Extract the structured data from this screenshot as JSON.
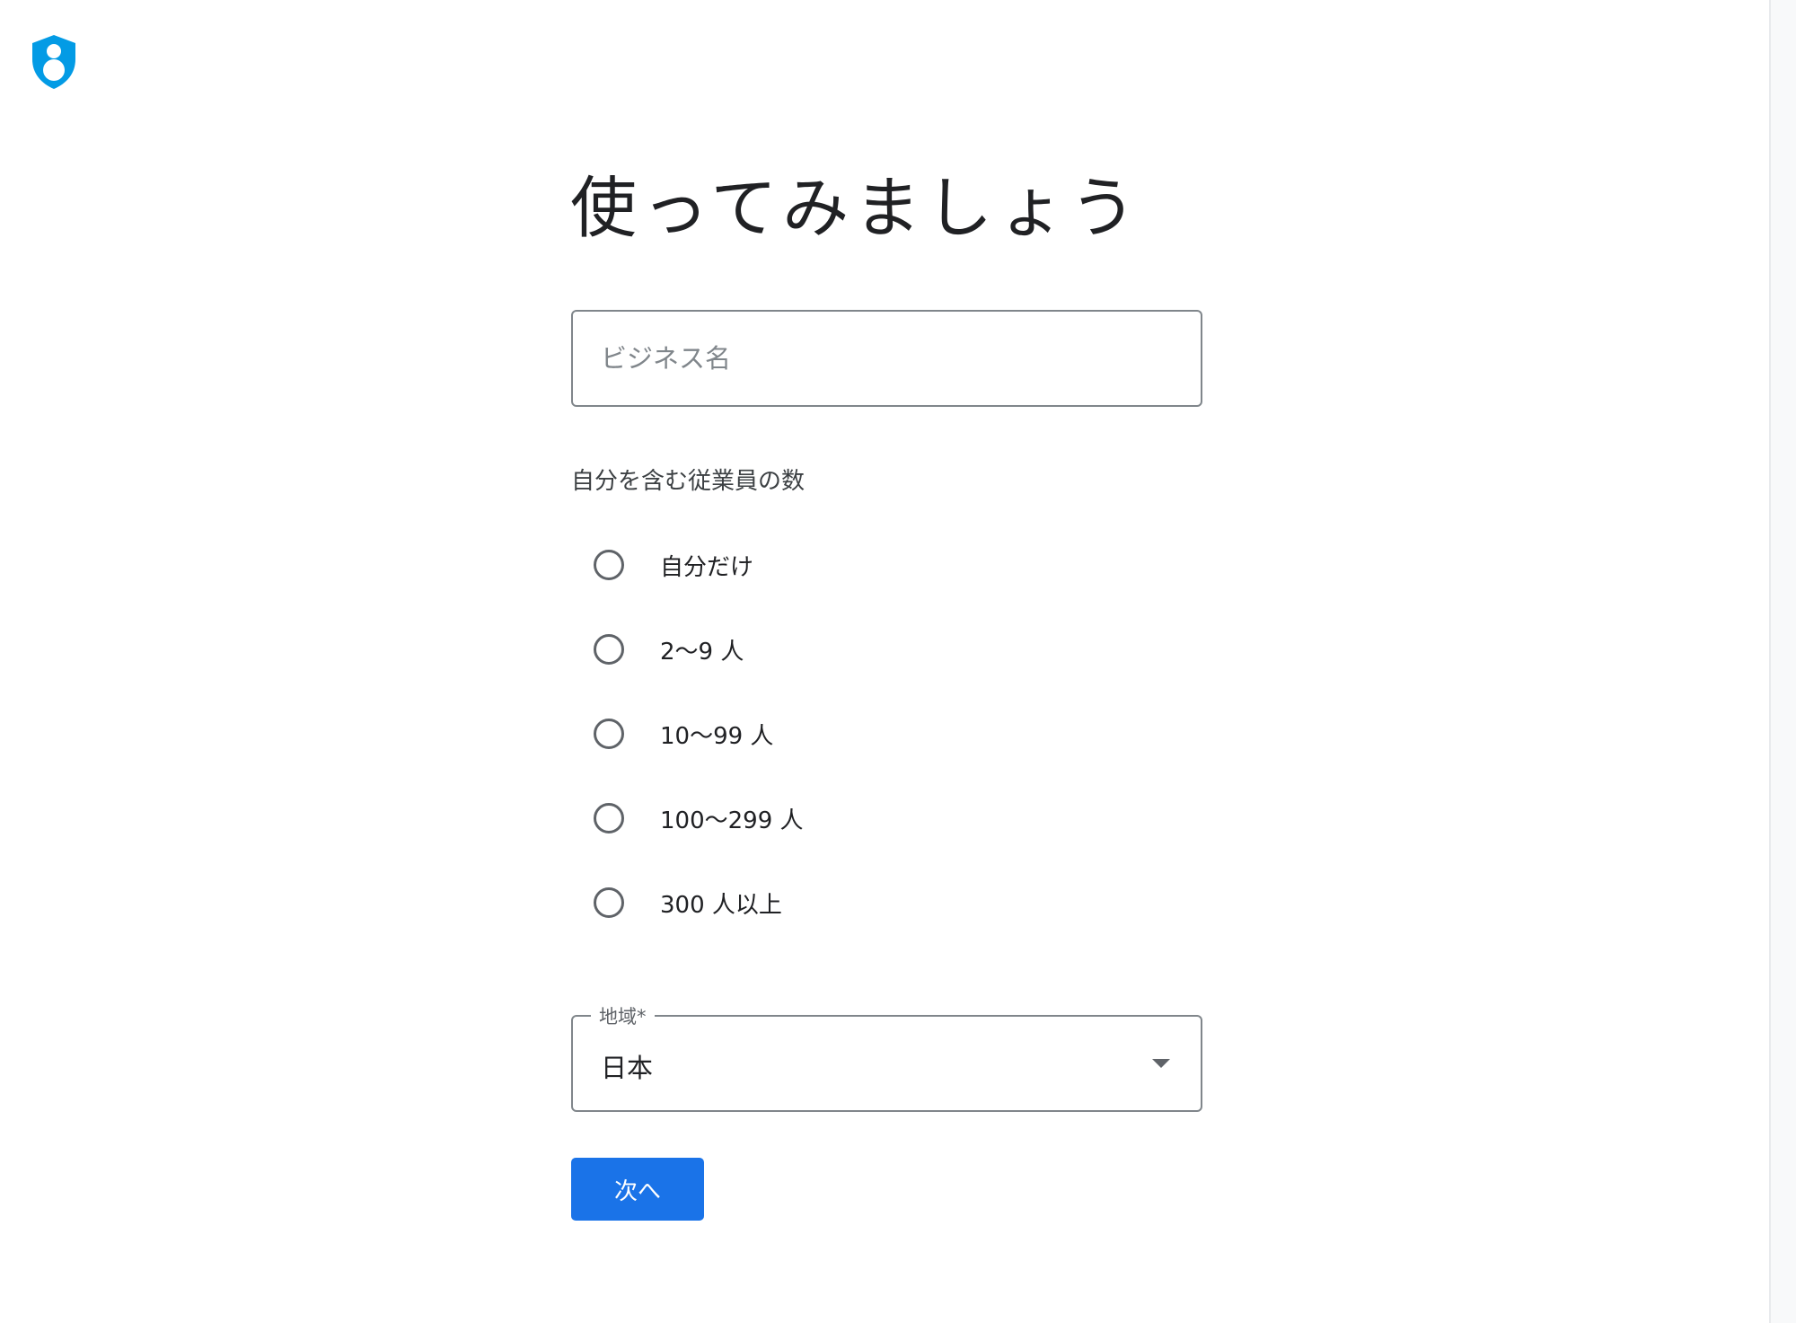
{
  "app": {
    "logo_icon": "shield-person-icon",
    "accent_color": "#1a73e8"
  },
  "page": {
    "title": "使ってみましょう"
  },
  "business_name": {
    "placeholder": "ビジネス名",
    "value": ""
  },
  "employees": {
    "label": "自分を含む従業員の数",
    "options": [
      {
        "label": "自分だけ",
        "selected": false
      },
      {
        "label": "2〜9 人",
        "selected": false
      },
      {
        "label": "10〜99 人",
        "selected": false
      },
      {
        "label": "100〜299 人",
        "selected": false
      },
      {
        "label": "300 人以上",
        "selected": false
      }
    ]
  },
  "region": {
    "label": "地域*",
    "value": "日本",
    "icon": "arrow-drop-down-icon"
  },
  "actions": {
    "next_label": "次へ"
  }
}
